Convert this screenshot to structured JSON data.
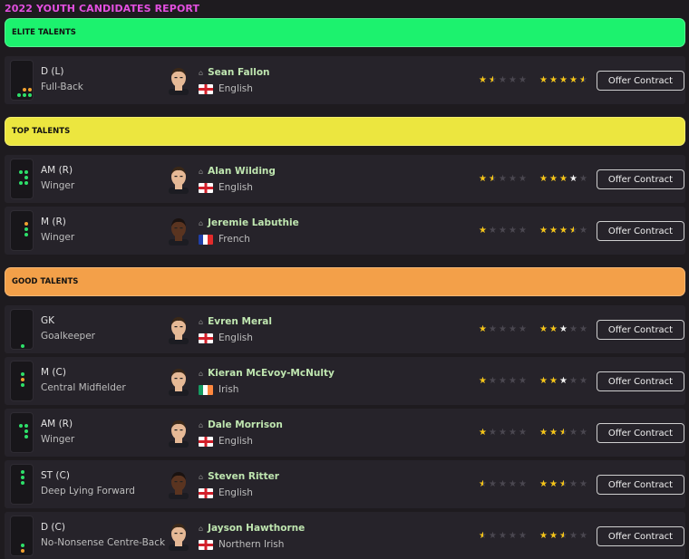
{
  "report": {
    "title": "2022 YOUTH CANDIDATES REPORT"
  },
  "colors": {
    "elite": "#1cf26e",
    "top": "#ece63f",
    "good": "#f3a049",
    "star_gold": "#f5c518",
    "player_name": "#bfe6b0"
  },
  "sections": [
    {
      "title": "ELITE TALENTS",
      "color": "#1cf26e",
      "players": [
        {
          "position": "D (L)",
          "role": "Full-Back",
          "name": "Sean Fallon",
          "nationality": "English",
          "flag": "england",
          "ca_stars": 1.5,
          "pa_stars": 4.5,
          "pa_star_color": "gold",
          "action": "Offer Contract",
          "skin": "light",
          "pitch_dots": [
            [
              "green",
              1,
              0
            ],
            [
              "orange",
              0,
              1
            ],
            [
              "green",
              1,
              2
            ],
            [
              "orange",
              2,
              2
            ]
          ]
        },
        {
          "position": "AM (R)",
          "role": "Winger",
          "name": "Alan Wilding",
          "nationality": "English",
          "flag": "england",
          "ca_stars": 1.5,
          "pa_stars": 4,
          "pa_star_color": "white-last",
          "action": "Offer Contract",
          "skin": "light",
          "pitch_dots": [
            [
              "green",
              1,
              0
            ],
            [
              "green",
              2,
              0
            ],
            [
              "green",
              1,
              1
            ],
            [
              "green",
              2,
              1
            ]
          ]
        }
      ]
    }
  ],
  "headers": {
    "elite": "ELITE TALENTS",
    "top": "TOP TALENTS",
    "good": "GOOD TALENTS"
  },
  "players": [
    {
      "position": "D (L)",
      "role": "Full-Back",
      "name": "Sean Fallon",
      "nationality": "English",
      "flag": "england",
      "ca": 1.5,
      "pa": 4.5,
      "pa_white_last": false,
      "action": "Offer Contract",
      "skin": "light"
    },
    {
      "position": "AM (R)",
      "role": "Winger",
      "name": "Alan Wilding",
      "nationality": "English",
      "flag": "england",
      "ca": 1.5,
      "pa": 4,
      "pa_white_last": true,
      "action": "Offer Contract",
      "skin": "light"
    },
    {
      "position": "M (R)",
      "role": "Winger",
      "name": "Jeremie Labuthie",
      "nationality": "French",
      "flag": "france",
      "ca": 1,
      "pa": 3.5,
      "pa_white_last": true,
      "action": "Offer Contract",
      "skin": "dark"
    },
    {
      "position": "GK",
      "role": "Goalkeeper",
      "name": "Evren Meral",
      "nationality": "English",
      "flag": "england",
      "ca": 1,
      "pa": 3,
      "pa_white_last": true,
      "action": "Offer Contract",
      "skin": "light"
    },
    {
      "position": "M (C)",
      "role": "Central Midfielder",
      "name": "Kieran McEvoy-McNulty",
      "nationality": "Irish",
      "flag": "ireland",
      "ca": 1,
      "pa": 3,
      "pa_white_last": true,
      "action": "Offer Contract",
      "skin": "light"
    },
    {
      "position": "AM (R)",
      "role": "Winger",
      "name": "Dale Morrison",
      "nationality": "English",
      "flag": "england",
      "ca": 1,
      "pa": 2.5,
      "pa_white_last": true,
      "action": "Offer Contract",
      "skin": "light"
    },
    {
      "position": "ST (C)",
      "role": "Deep Lying Forward",
      "name": "Steven Ritter",
      "nationality": "English",
      "flag": "england",
      "ca": 0.5,
      "pa": 2.5,
      "pa_white_last": true,
      "action": "Offer Contract",
      "skin": "dark"
    },
    {
      "position": "D (C)",
      "role": "No-Nonsense Centre-Back",
      "name": "Jayson Hawthorne",
      "nationality": "Northern Irish",
      "flag": "england",
      "ca": 0.5,
      "pa": 2.5,
      "pa_white_last": true,
      "action": "Offer Contract",
      "skin": "light"
    }
  ]
}
